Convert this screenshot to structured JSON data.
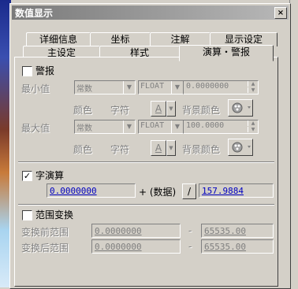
{
  "window": {
    "title": "数值显示",
    "close_label": "×"
  },
  "tabs_back": [
    "详细信息",
    "坐标",
    "注解",
    "显示设定"
  ],
  "tabs_front": [
    "主设定",
    "样式",
    "演算・警报"
  ],
  "alarm": {
    "checkbox_label": "警报",
    "checked": false,
    "min_label": "最小值",
    "max_label": "最大值",
    "min": {
      "type": "常数",
      "format": "FLOAT",
      "value": "0.0000000"
    },
    "max": {
      "type": "常数",
      "format": "FLOAT",
      "value": "100.0000"
    },
    "color_label": "颜色",
    "char_label": "字符",
    "char_button": "A",
    "bg_color_label": "背景颜色"
  },
  "calc": {
    "checkbox_label": "字演算",
    "checked": true,
    "operand1": "0.0000000",
    "expr_label": "+ (数据)",
    "op_button": "/",
    "operand2": "157.9884"
  },
  "range": {
    "checkbox_label": "范围变换",
    "checked": false,
    "before_label": "变换前范围",
    "after_label": "变换后范围",
    "before_min": "0.0000000",
    "before_max": "65535.00",
    "after_min": "0.0000000",
    "after_max": "65535.00",
    "dash": "-"
  }
}
